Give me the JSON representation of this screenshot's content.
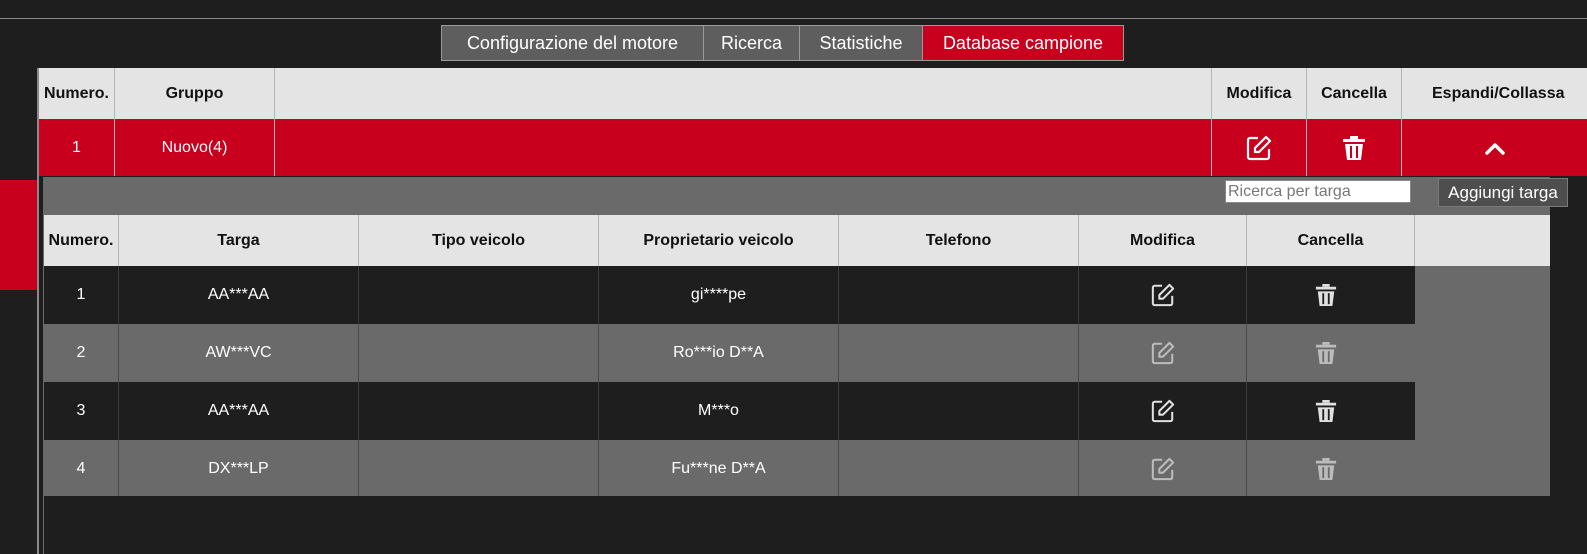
{
  "tabs": [
    {
      "label": "Configurazione del motore",
      "active": false
    },
    {
      "label": "Ricerca",
      "active": false
    },
    {
      "label": "Statistiche",
      "active": false
    },
    {
      "label": "Database campione",
      "active": true
    }
  ],
  "groups_table": {
    "headers": {
      "number": "Numero.",
      "group": "Gruppo",
      "edit": "Modifica",
      "delete": "Cancella",
      "expand": "Espandi/Collassa"
    },
    "rows": [
      {
        "number": "1",
        "group": "Nuovo(4)"
      }
    ]
  },
  "plate_search": {
    "placeholder": "Ricerca per targa",
    "value": ""
  },
  "add_plate_label": "Aggiungi targa",
  "plates_table": {
    "headers": {
      "number": "Numero.",
      "plate": "Targa",
      "vehicle_type": "Tipo veicolo",
      "owner": "Proprietario veicolo",
      "phone": "Telefono",
      "edit": "Modifica",
      "delete": "Cancella"
    },
    "rows": [
      {
        "number": "1",
        "plate": "AA***AA",
        "vehicle_type": "",
        "owner": "gi****pe",
        "phone": ""
      },
      {
        "number": "2",
        "plate": "AW***VC",
        "vehicle_type": "",
        "owner": "Ro***io D**A",
        "phone": ""
      },
      {
        "number": "3",
        "plate": "AA***AA",
        "vehicle_type": "",
        "owner": "M***o",
        "phone": ""
      },
      {
        "number": "4",
        "plate": "DX***LP",
        "vehicle_type": "",
        "owner": "Fu***ne D**A",
        "phone": ""
      }
    ]
  },
  "colors": {
    "accent": "#c8001e",
    "header_bg": "#e4e4e4",
    "dark_bg": "#1e1e1e",
    "mid_bg": "#6a6a6a"
  },
  "icons": {
    "edit": "edit-icon",
    "delete": "trash-icon",
    "collapse": "chevron-up-icon"
  }
}
